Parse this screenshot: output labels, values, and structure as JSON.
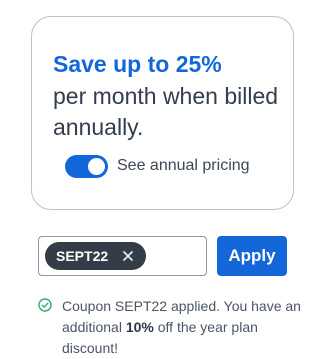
{
  "promo": {
    "headline": "Save up to 25%",
    "subtext": "per month when billed annually.",
    "toggle": {
      "label": "See annual pricing",
      "on": true
    }
  },
  "coupon": {
    "code": "SEPT22",
    "apply_label": "Apply"
  },
  "status": {
    "text_prefix": "Coupon SEPT22 applied. You have an additional ",
    "text_bold": "10%",
    "text_suffix": " off the year plan discount!"
  },
  "colors": {
    "accent": "#1467d8",
    "chip": "#343c48",
    "success": "#2eaf6e"
  },
  "icons": {
    "chip_close": "close-icon",
    "status": "check-circle-icon"
  }
}
